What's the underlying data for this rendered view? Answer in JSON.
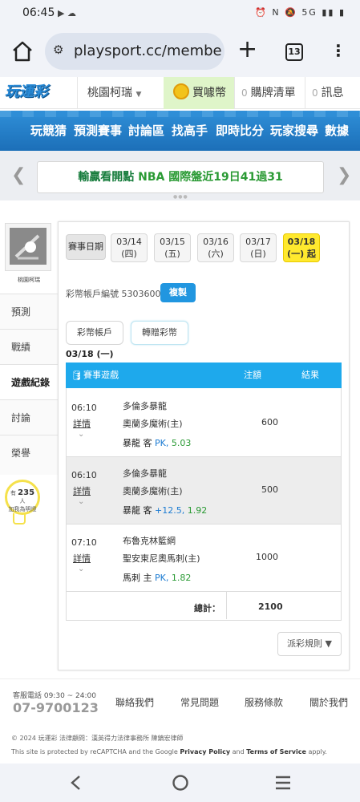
{
  "status_bar": {
    "time": "06:45",
    "network": "5G"
  },
  "browser": {
    "url": "playsport.cc/member/",
    "tab_count": "13"
  },
  "site_header": {
    "logo": "玩運彩",
    "user_name": "桃園柯瑞",
    "coin_label": "買噱幣",
    "cart_count": "0",
    "cart_label": "購牌清單",
    "msg_count": "0",
    "msg_label": "訊息"
  },
  "nav": {
    "items": [
      "玩競猜",
      "預測賽事",
      "討論區",
      "找高手",
      "即時比分",
      "玩家搜尋",
      "數據"
    ]
  },
  "ticker": {
    "prefix": "輸贏看開點",
    "text": "NBA 國際盤近19日41過31"
  },
  "sidebar": {
    "avatar_name": "桃園柯瑞",
    "items": [
      "預測",
      "戰績",
      "遊戲紀錄",
      "討論",
      "榮譽"
    ],
    "active": "遊戲紀錄",
    "bulb_prefix": "有",
    "bulb_count": "235",
    "bulb_unit": "人",
    "bulb_text": "加我為明燈"
  },
  "main": {
    "date_label": "賽事日期",
    "dates": [
      {
        "date": "03/14",
        "day": "(四)"
      },
      {
        "date": "03/15",
        "day": "(五)"
      },
      {
        "date": "03/16",
        "day": "(六)"
      },
      {
        "date": "03/17",
        "day": "(日)"
      },
      {
        "date": "03/18",
        "day": "(一) 起"
      }
    ],
    "selected_date": "03/18",
    "account_label": "彩幣帳戶編號",
    "account_no": "53036002",
    "copy_label": "複製",
    "tab_account": "彩幣帳戶",
    "tab_transfer": "轉贈彩幣",
    "date_heading": "03/18 (一)",
    "table": {
      "headers": [
        "賽事遊戲",
        "注額",
        "結果"
      ],
      "rows": [
        {
          "time": "06:10",
          "detail": "詳情",
          "home": "多倫多暴龍",
          "away": "奧蘭多魔術(主)",
          "pick_team": "暴龍",
          "pick_side": "客",
          "pick_type": "PK,",
          "pick_odds": "5.03",
          "stake": "600",
          "result": ""
        },
        {
          "time": "06:10",
          "detail": "詳情",
          "home": "多倫多暴龍",
          "away": "奧蘭多魔術(主)",
          "pick_team": "暴龍",
          "pick_side": "客",
          "pick_type": "+12.5,",
          "pick_odds": "1.92",
          "stake": "500",
          "result": ""
        },
        {
          "time": "07:10",
          "detail": "詳情",
          "home": "布魯克林籃網",
          "away": "聖安東尼奧馬刺(主)",
          "pick_team": "馬刺",
          "pick_side": "主",
          "pick_type": "PK,",
          "pick_odds": "1.82",
          "stake": "1000",
          "result": ""
        }
      ],
      "total_label": "總計：",
      "total_value": "2100"
    },
    "rules_label": "派彩規則 ▼"
  },
  "footer": {
    "service_hours": "客服電話 09:30 ~ 24:00",
    "service_phone": "07-9700123",
    "links": [
      "聯絡我們",
      "常見問題",
      "服務條款",
      "關於我們"
    ],
    "copyright": "© 2024 玩運彩  法律顧問：漢英得力法律事務所 陳鎮宏律師",
    "recaptcha_prefix": "This site is protected by reCAPTCHA and the Google",
    "privacy": "Privacy Policy",
    "and": "and",
    "terms": "Terms of Service",
    "apply": "apply."
  },
  "colors": {
    "accent": "#1ea9ec",
    "nav": "#1c6fb8",
    "selected_date": "#ffe92e",
    "coin_bg": "#dff5c9"
  }
}
